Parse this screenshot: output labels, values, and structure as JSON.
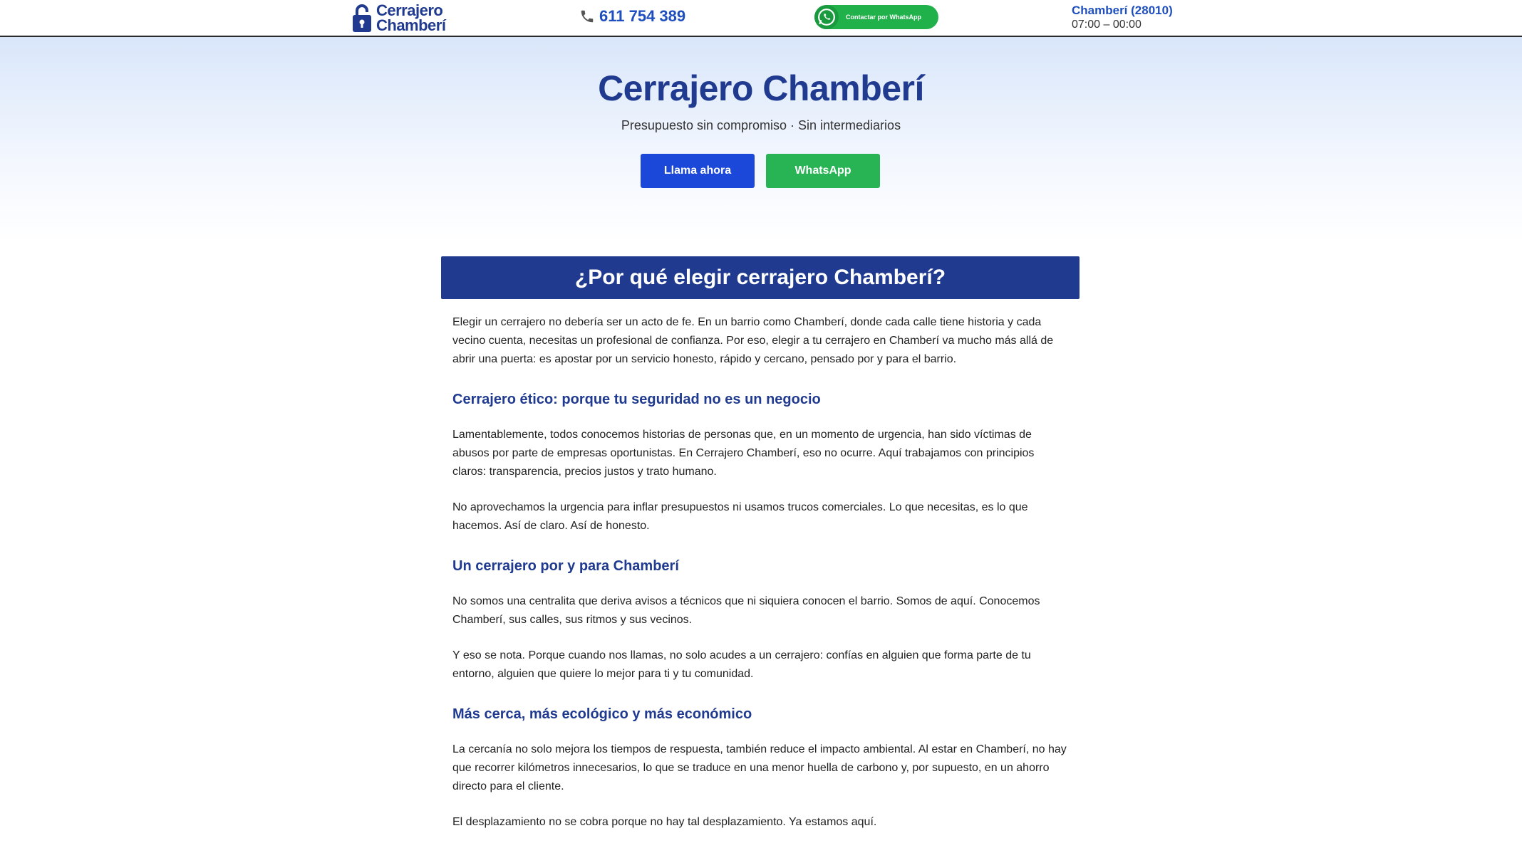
{
  "header": {
    "logo_line1": "Cerrajero",
    "logo_line2": "Chamberí",
    "phone": "611 754 389",
    "whatsapp_badge": "Contactar por WhatsApp",
    "location_name": "Chamberí (28010)",
    "location_hours": "07:00 – 00:00"
  },
  "hero": {
    "title": "Cerrajero Chamberí",
    "subtitle": "Presupuesto sin compromiso · Sin intermediarios",
    "call_button": "Llama ahora",
    "whatsapp_button": "WhatsApp"
  },
  "section": {
    "title": "¿Por qué elegir cerrajero Chamberí?",
    "intro": "Elegir un cerrajero no debería ser un acto de fe. En un barrio como Chamberí, donde cada calle tiene historia y cada vecino cuenta, necesitas un profesional de confianza. Por eso, elegir a tu cerrajero en Chamberí va mucho más allá de abrir una puerta: es apostar por un servicio honesto, rápido y cercano, pensado por y para el barrio.",
    "blocks": [
      {
        "heading": "Cerrajero ético: porque tu seguridad no es un negocio",
        "paragraphs": [
          "Lamentablemente, todos conocemos historias de personas que, en un momento de urgencia, han sido víctimas de abusos por parte de empresas oportunistas. En Cerrajero Chamberí, eso no ocurre. Aquí trabajamos con principios claros: transparencia, precios justos y trato humano.",
          "No aprovechamos la urgencia para inflar presupuestos ni usamos trucos comerciales. Lo que necesitas, es lo que hacemos. Así de claro. Así de honesto."
        ]
      },
      {
        "heading": "Un cerrajero por y para Chamberí",
        "paragraphs": [
          "No somos una centralita que deriva avisos a técnicos que ni siquiera conocen el barrio. Somos de aquí. Conocemos Chamberí, sus calles, sus ritmos y sus vecinos.",
          "Y eso se nota. Porque cuando nos llamas, no solo acudes a un cerrajero: confías en alguien que forma parte de tu entorno, alguien que quiere lo mejor para ti y tu comunidad."
        ]
      },
      {
        "heading": "Más cerca, más ecológico y más económico",
        "paragraphs": [
          "La cercanía no solo mejora los tiempos de respuesta, también reduce el impacto ambiental. Al estar en Chamberí, no hay que recorrer kilómetros innecesarios, lo que se traduce en una menor huella de carbono y, por supuesto, en un ahorro directo para el cliente.",
          "El desplazamiento no se cobra porque no hay tal desplazamiento. Ya estamos aquí."
        ]
      }
    ]
  },
  "colors": {
    "brand_blue": "#1f3a8f",
    "link_blue": "#1f4fbf",
    "call_button": "#1c48d9",
    "whatsapp_green": "#28b455"
  },
  "icons": [
    "lock-icon",
    "phone-icon",
    "whatsapp-icon"
  ]
}
